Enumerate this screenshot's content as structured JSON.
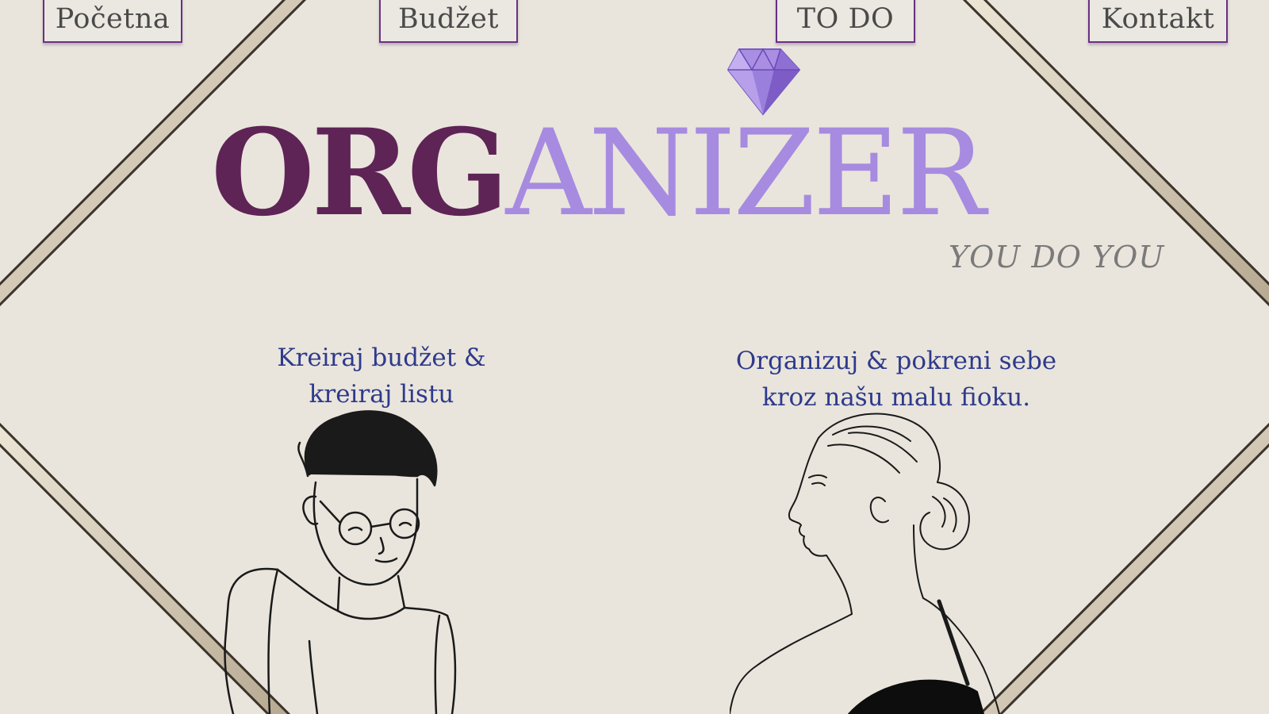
{
  "nav": {
    "items": [
      {
        "label": "Početna"
      },
      {
        "label": "Budžet"
      },
      {
        "label": "TO DO"
      },
      {
        "label": "Kontakt"
      }
    ]
  },
  "brand": {
    "part_a": "ORG",
    "part_b": "ANIZER",
    "tagline": "YOU DO YOU",
    "logo_icon": "diamond-icon"
  },
  "features": {
    "left": {
      "line1": "Kreiraj budžet &",
      "line2": "kreiraj listu",
      "illustration": "man-with-glasses-illustration"
    },
    "right": {
      "line1": "Organizuj & pokreni sebe",
      "line2": "kroz našu malu fioku.",
      "illustration": "woman-profile-illustration"
    }
  },
  "colors": {
    "background": "#e9e5dc",
    "brand_dark": "#5e2456",
    "brand_light": "#a78be0",
    "caption": "#2e3a8c",
    "nav_border": "#6a2f86"
  }
}
